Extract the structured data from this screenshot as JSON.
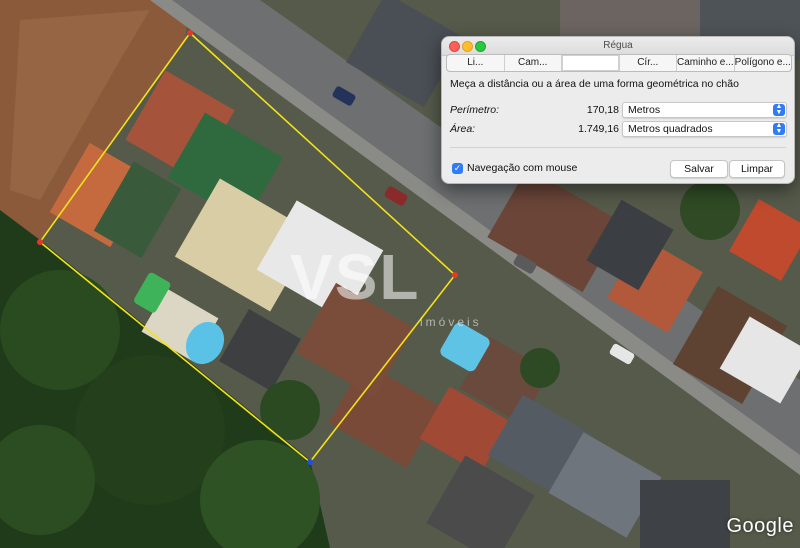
{
  "window": {
    "title": "Régua",
    "tabs": [
      "Li...",
      "Cam...",
      "",
      "Cír...",
      "Caminho e...",
      "Polígono e..."
    ],
    "active_tab_index": 2,
    "description": "Meça a distância ou a área de uma forma geométrica no chão",
    "perimeter": {
      "label": "Perímetro:",
      "value": "170,18",
      "unit": "Metros"
    },
    "area": {
      "label": "Área:",
      "value": "1.749,16",
      "unit": "Metros quadrados"
    },
    "mouse_nav": {
      "label": "Navegação com mouse",
      "checked": true
    },
    "save_label": "Salvar",
    "clear_label": "Limpar"
  },
  "map": {
    "attribution": "Google",
    "watermark": "VSL",
    "watermark_sub": "imóveis",
    "measure_line_color": "#f2e21a",
    "vertex_color": "#1f4fe0"
  },
  "colors": {
    "accent": "#2f7cf6",
    "panel_bg": "#ececec"
  }
}
